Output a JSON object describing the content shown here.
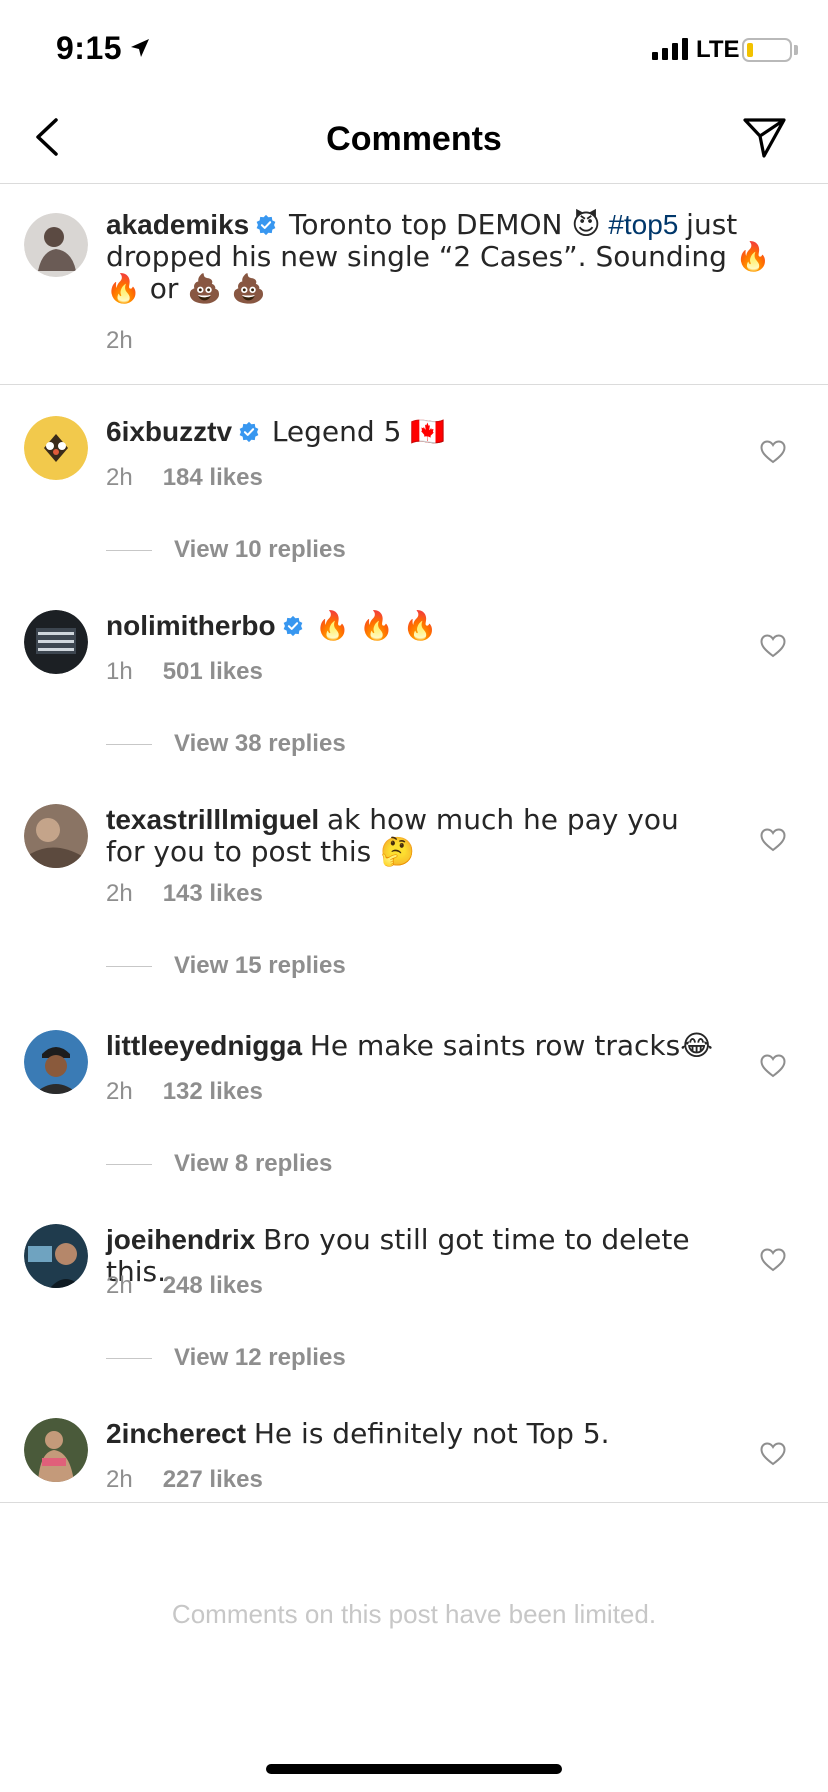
{
  "status_bar": {
    "time": "9:15",
    "network": "LTE"
  },
  "header": {
    "title": "Comments"
  },
  "caption": {
    "username": "akademiks",
    "text_before_hashtag": "Toronto top DEMON 😈",
    "hashtag": "#top5",
    "text_after_hashtag": "just dropped his new single “2 Cases”. Sounding 🔥 🔥 or 💩 💩",
    "time": "2h"
  },
  "comments": [
    {
      "username": "6ixbuzztv",
      "verified": true,
      "text": "Legend 5 🇨🇦",
      "time": "2h",
      "likes": "184 likes",
      "replies": "View 10 replies"
    },
    {
      "username": "nolimitherbo",
      "verified": true,
      "text": "🔥 🔥 🔥",
      "time": "1h",
      "likes": "501 likes",
      "replies": "View 38 replies"
    },
    {
      "username": "texastrilllmiguel",
      "verified": false,
      "text": "ak how much he pay you for you to post this 🤔",
      "time": "2h",
      "likes": "143 likes",
      "replies": "View 15 replies"
    },
    {
      "username": "littleeyednigga",
      "verified": false,
      "text": "He make saints row tracks😂",
      "time": "2h",
      "likes": "132 likes",
      "replies": "View 8 replies"
    },
    {
      "username": "joeihendrix",
      "verified": false,
      "text": "Bro you still got time to delete this.",
      "time": "2h",
      "likes": "248 likes",
      "replies": "View 12 replies"
    },
    {
      "username": "2incherect",
      "verified": false,
      "text": "He is definitely not Top 5.",
      "time": "2h",
      "likes": "227 likes"
    }
  ],
  "footer": {
    "limited_text": "Comments on this post have been limited."
  },
  "icons": {
    "back": "chevron-left-icon",
    "send": "paper-plane-icon",
    "verified": "verified-badge-icon",
    "like": "heart-outline-icon"
  },
  "colors": {
    "verified": "#3897f0",
    "hashtag": "#00376b",
    "secondary_text": "#8e8e8e",
    "battery": "#f2c200"
  }
}
